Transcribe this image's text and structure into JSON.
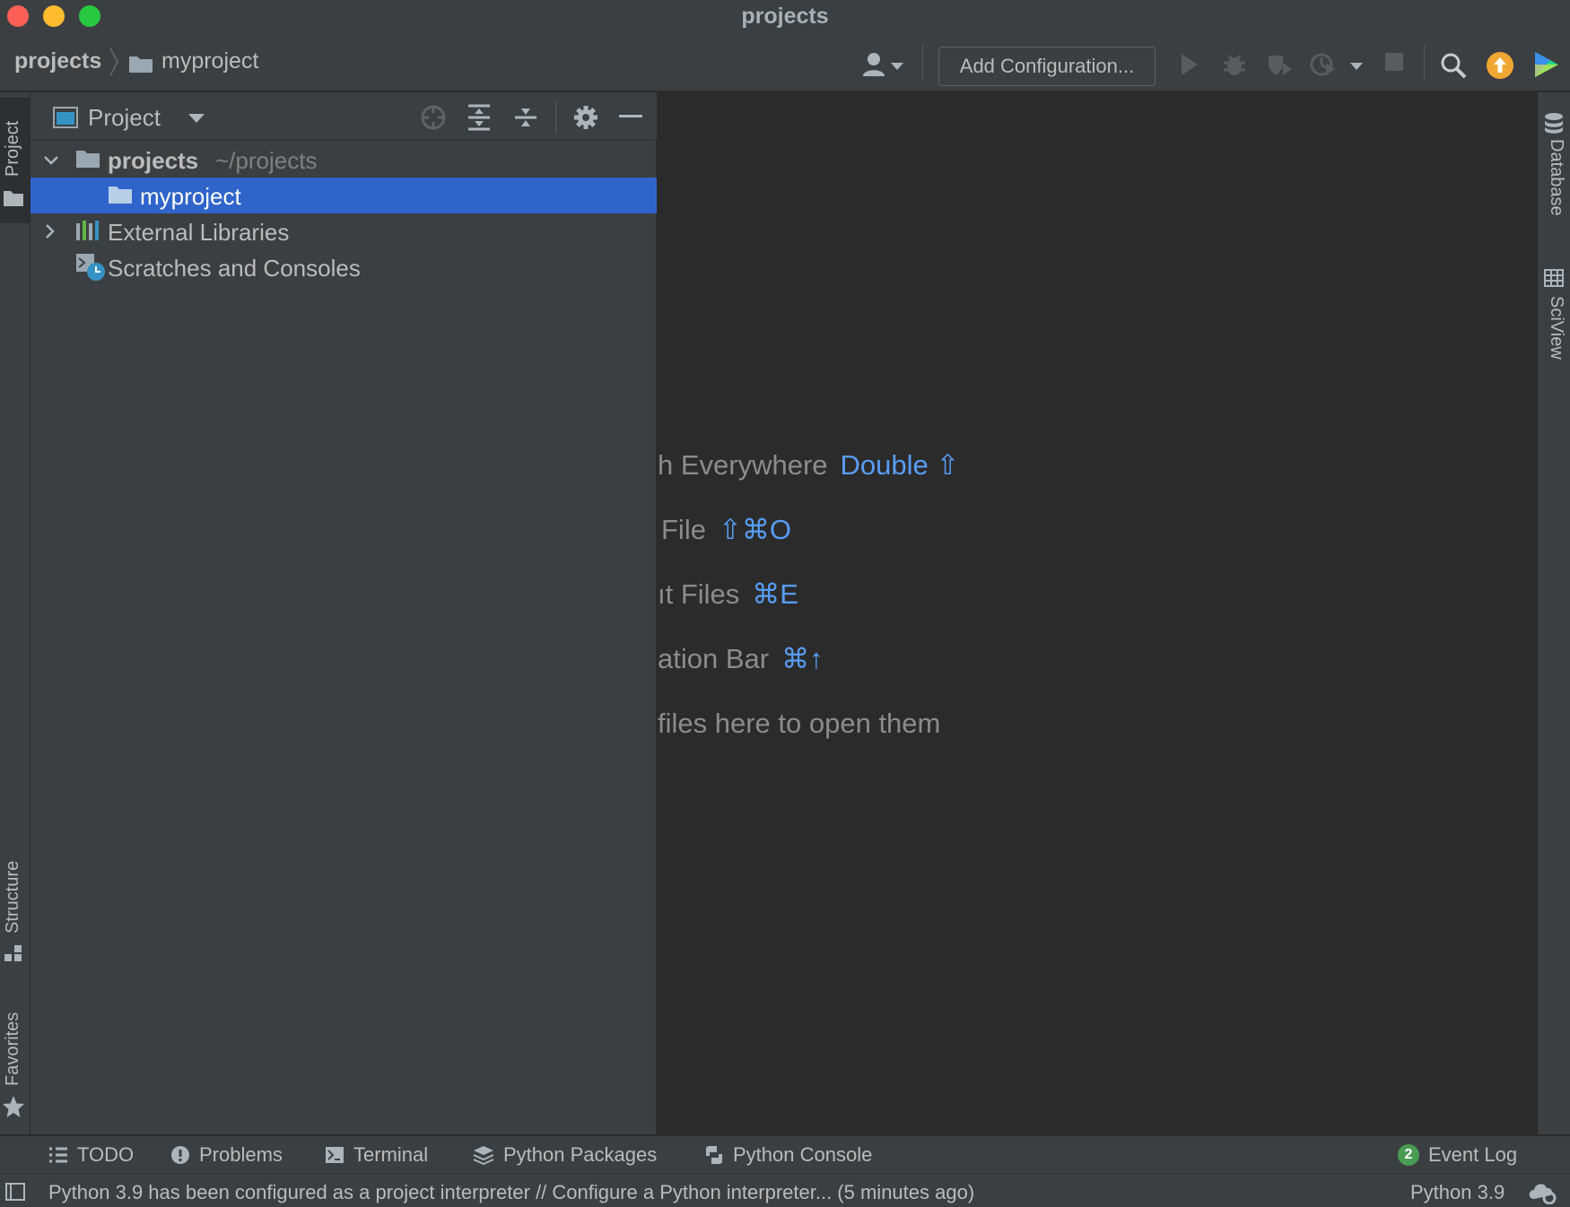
{
  "window": {
    "title": "projects"
  },
  "breadcrumb": {
    "root": "projects",
    "child": "myproject"
  },
  "toolbar": {
    "add_config_label": "Add Configuration...",
    "icons": [
      "user-icon",
      "run-icon",
      "debug-icon",
      "coverage-icon",
      "profile-icon",
      "stop-icon",
      "search-icon",
      "update-icon",
      "toolbox-icon"
    ]
  },
  "left_strip": {
    "project": "Project",
    "structure": "Structure",
    "favorites": "Favorites"
  },
  "right_strip": {
    "database": "Database",
    "sciview": "SciView"
  },
  "project_panel": {
    "title": "Project",
    "tree": [
      {
        "label": "projects",
        "path": "~/projects",
        "expanded": true
      },
      {
        "label": "myproject",
        "selected": true
      },
      {
        "label": "External Libraries",
        "expanded": false
      },
      {
        "label": "Scratches and Consoles"
      }
    ]
  },
  "editor_hints": [
    {
      "text": "h Everywhere",
      "shortcut": "Double ⇧"
    },
    {
      "text": "File",
      "shortcut": "⇧⌘O"
    },
    {
      "text": "ıt Files",
      "shortcut": "⌘E"
    },
    {
      "text": "ation Bar",
      "shortcut": "⌘↑"
    },
    {
      "text": "files here to open them",
      "shortcut": ""
    }
  ],
  "bottom_tools": {
    "todo": "TODO",
    "problems": "Problems",
    "terminal": "Terminal",
    "python_packages": "Python Packages",
    "python_console": "Python Console",
    "event_log": "Event Log",
    "event_count": "2"
  },
  "status": {
    "message": "Python 3.9 has been configured as a project interpreter // Configure a Python interpreter... (5 minutes ago)",
    "interpreter": "Python 3.9"
  },
  "colors": {
    "selection": "#2f65ca",
    "shortcut_blue": "#589df6",
    "update_orange": "#f0a732",
    "event_green": "#499c54"
  }
}
